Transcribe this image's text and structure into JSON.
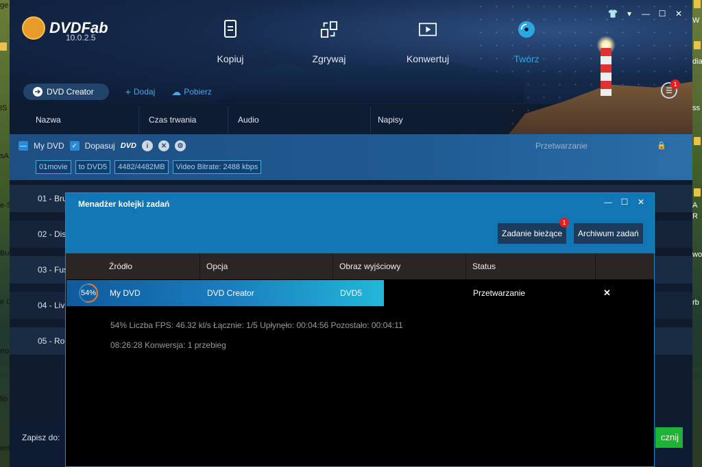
{
  "desktop": {
    "left_labels": [
      "ge",
      "IS",
      "sA",
      "e-S",
      "Bu",
      "e C",
      "rro",
      "lio",
      "ent"
    ],
    "right_labels": [
      "W",
      "dia",
      "ss",
      "A",
      "R",
      "wo",
      "rb"
    ]
  },
  "app": {
    "logo_text": "DVDFab",
    "version": "10.0.2.5",
    "nav": [
      {
        "label": "Kopiuj",
        "icon": "copy-icon"
      },
      {
        "label": "Zgrywaj",
        "icon": "ripper-icon"
      },
      {
        "label": "Konwertuj",
        "icon": "converter-icon"
      },
      {
        "label": "Twórz",
        "icon": "creator-disc-icon",
        "active": true
      }
    ],
    "subbar": {
      "creator_label": "DVD Creator",
      "add_label": "Dodaj",
      "download_label": "Pobierz"
    },
    "queue_badge": "1",
    "columns": {
      "name": "Nazwa",
      "duration": "Czas trwania",
      "audio": "Audio",
      "subtitles": "Napisy"
    },
    "title_row": {
      "name": "My DVD",
      "fit_label": "Dopasuj",
      "dvd_logo": "DVD",
      "status": "Przetwarzanie",
      "tags": [
        "01movie",
        "to DVD5",
        "4482/4482MB",
        "Video Bitrate: 2488 kbps"
      ]
    },
    "list_items": [
      "01 - Bru",
      "02 - Dis",
      "03 - Fus",
      "04 - Liv",
      "05 - Ro"
    ],
    "footer": {
      "save_label": "Zapisz do:",
      "start_label": "cznij"
    }
  },
  "modal": {
    "title": "Menadżer kolejki zadań",
    "btn_current": "Zadanie bieżące",
    "btn_current_badge": "1",
    "btn_archive": "Archiwum zadań",
    "columns": {
      "source": "Źródło",
      "option": "Opcja",
      "output": "Obraz wyjściowy",
      "status": "Status"
    },
    "task": {
      "progress_label": "54%",
      "progress": 0.54,
      "source": "My DVD",
      "option": "DVD Creator",
      "output": "DVD5",
      "status": "Przetwarzanie"
    },
    "details": {
      "line1": "54%  Liczba FPS: 46.32 kl/s  Łącznie: 1/5  Upłynęło: 00:04:56  Pozostało: 00:04:11",
      "line2": "08:26:28   Konwersja: 1 przebieg"
    }
  }
}
